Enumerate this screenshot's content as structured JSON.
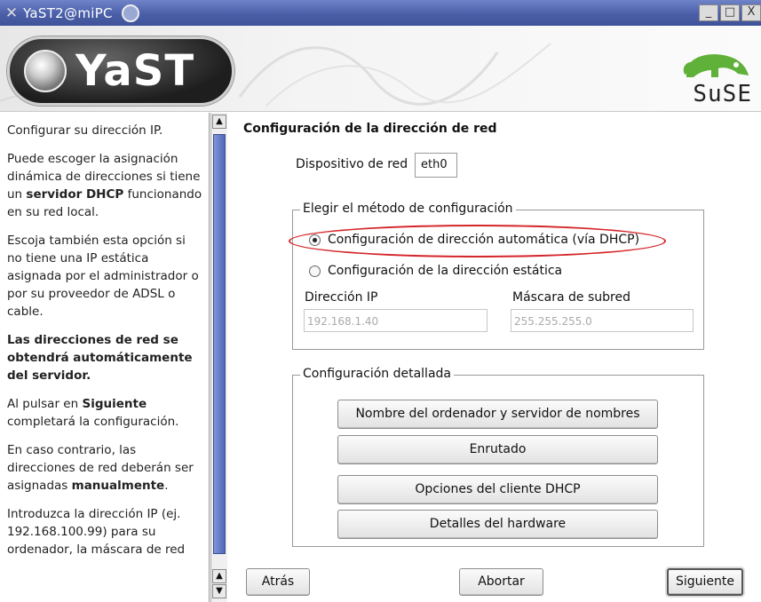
{
  "window": {
    "title": "YaST2@miPC",
    "controls": [
      "_",
      "□",
      "X"
    ]
  },
  "header": {
    "yast_logo": "YaST",
    "suse_logo": "SuSE"
  },
  "help": {
    "p1": "Configurar su dirección IP.",
    "p2": [
      "Puede escoger la asignación dinámica de direcciones si tiene un ",
      "servidor DHCP",
      " funcionando en su red local."
    ],
    "p3": "Escoja también esta opción si no tiene una IP estática asignada por el administrador o por su proveedor de ADSL o cable.",
    "p4": "Las direcciones de red se obtendrá automáticamente del servidor.",
    "p5": [
      "Al pulsar en ",
      "Siguiente",
      " completará la configuración."
    ],
    "p6": [
      "En caso contrario, las direcciones de red deberán ser asignadas ",
      "manualmente",
      "."
    ],
    "p7": "Introduzca la dirección IP (ej. 192.168.100.99) para su ordenador, la máscara de red"
  },
  "main": {
    "title": "Configuración de la dirección de red",
    "device_label": "Dispositivo de red",
    "device_value": "eth0",
    "method_group": "Elegir el método de configuración",
    "radio_dhcp": "Configuración de dirección automática (vía DHCP)",
    "radio_static": "Configuración de la dirección estática",
    "ip_label": "Dirección IP",
    "ip_value": "192.168.1.40",
    "mask_label": "Máscara de subred",
    "mask_value": "255.255.255.0",
    "detail_group": "Configuración detallada",
    "btn_hostname": "Nombre del ordenador y servidor de nombres",
    "btn_routing": "Enrutado",
    "btn_dhcp_opts": "Opciones del cliente DHCP",
    "btn_hardware": "Detalles del hardware"
  },
  "footer": {
    "back": "Atrás",
    "abort": "Abortar",
    "next": "Siguiente"
  },
  "colors": {
    "titlebar": "#4a5fa8",
    "highlight_oval": "#d5262a",
    "scroll_thumb": "#5068b8"
  }
}
